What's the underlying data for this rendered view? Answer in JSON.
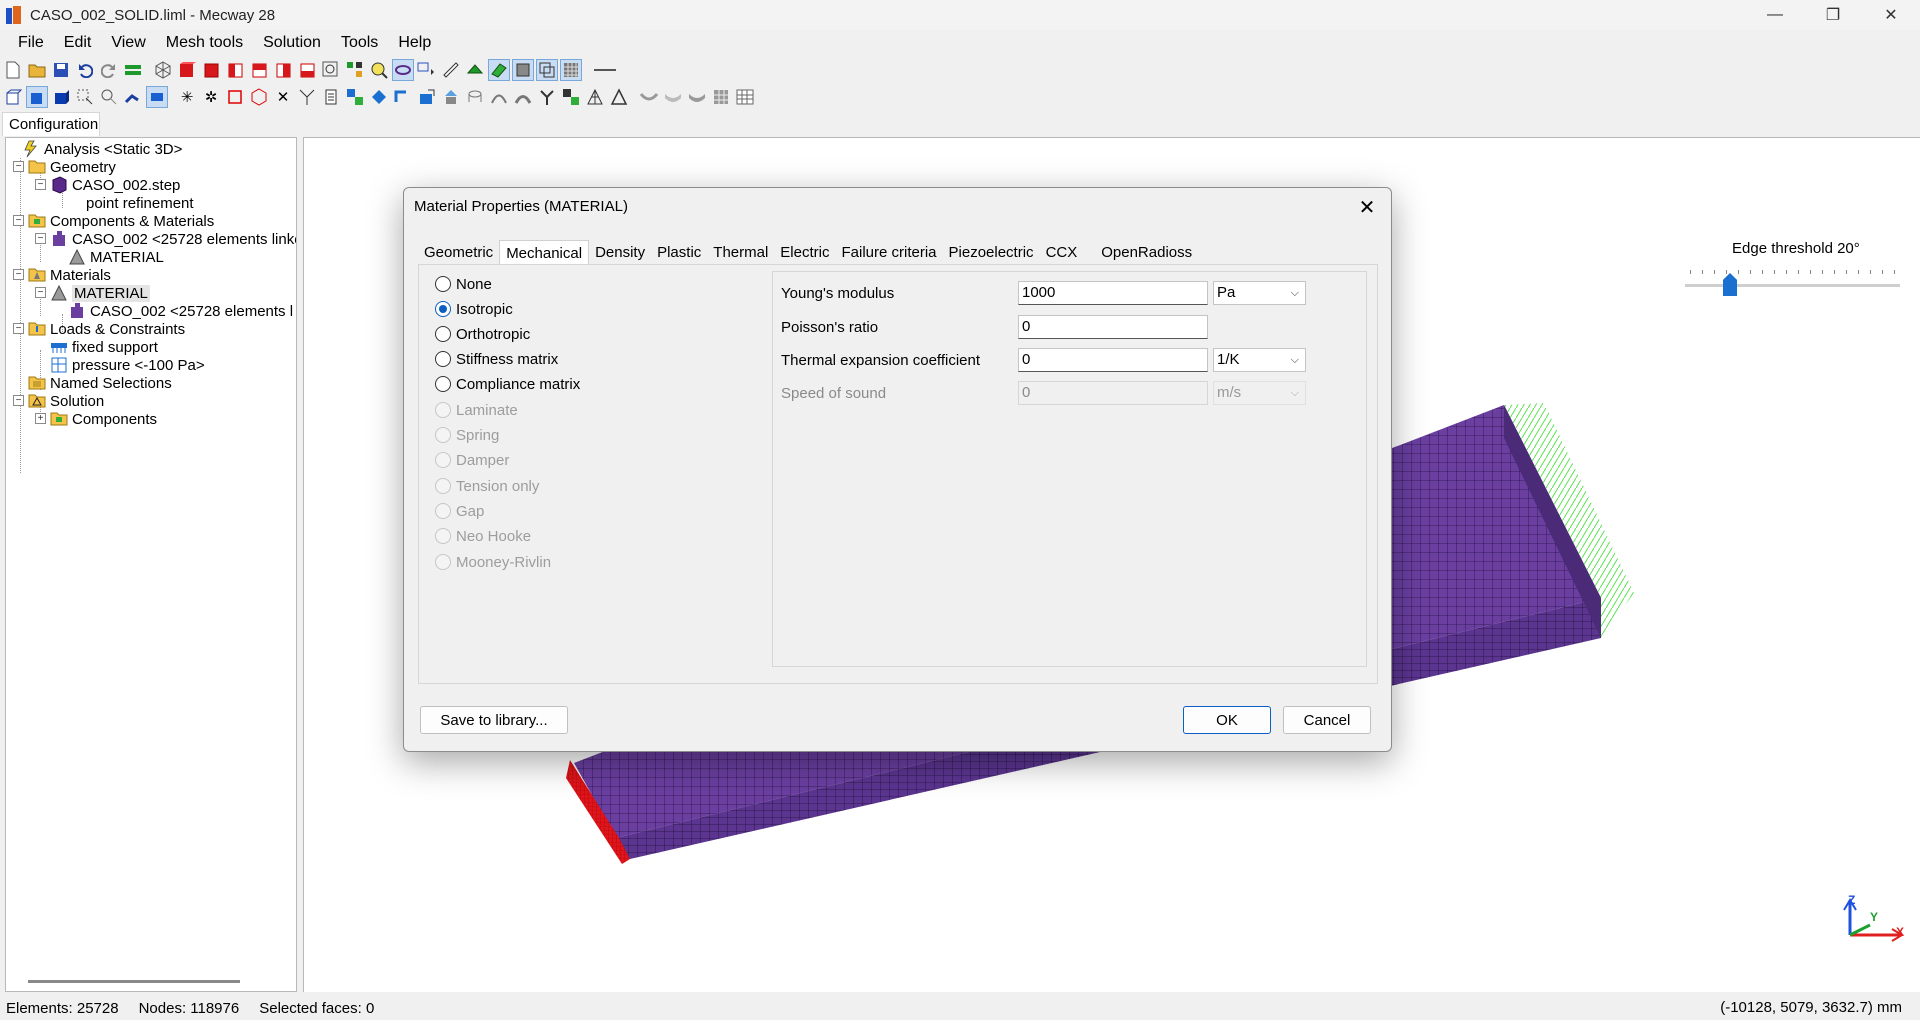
{
  "window": {
    "title": "CASO_002_SOLID.liml - Mecway 28",
    "minimize": "—",
    "restore": "❐",
    "close": "✕"
  },
  "menu": [
    "File",
    "Edit",
    "View",
    "Mesh tools",
    "Solution",
    "Tools",
    "Help"
  ],
  "config_tab": "Configuration",
  "tree": {
    "analysis": "Analysis <Static 3D>",
    "geometry": "Geometry",
    "geometry_file": "CASO_002.step",
    "point_refinement": "point refinement",
    "components_materials": "Components & Materials",
    "component_item": "CASO_002 <25728 elements linke",
    "component_material": "MATERIAL",
    "materials": "Materials",
    "material_item": "MATERIAL",
    "material_component": "CASO_002 <25728 elements l",
    "loads": "Loads & Constraints",
    "fixed_support": "fixed support",
    "pressure": "pressure <-100 Pa>",
    "named_selections": "Named Selections",
    "solution": "Solution",
    "solution_components": "Components"
  },
  "edge_threshold": {
    "label": "Edge threshold 20°",
    "value_deg": 20
  },
  "axes": {
    "x": "X",
    "y": "Y",
    "z": "Z"
  },
  "dialog": {
    "title": "Material Properties (MATERIAL)",
    "close": "✕",
    "tabs": [
      "Geometric",
      "Mechanical",
      "Density",
      "Plastic",
      "Thermal",
      "Electric",
      "Failure criteria",
      "Piezoelectric",
      "CCX",
      "OpenRadioss"
    ],
    "active_tab": "Mechanical",
    "models": [
      {
        "label": "None",
        "state": "enabled"
      },
      {
        "label": "Isotropic",
        "state": "checked"
      },
      {
        "label": "Orthotropic",
        "state": "enabled"
      },
      {
        "label": "Stiffness matrix",
        "state": "enabled"
      },
      {
        "label": "Compliance matrix",
        "state": "enabled"
      },
      {
        "label": "Laminate",
        "state": "disabled"
      },
      {
        "label": "Spring",
        "state": "disabled"
      },
      {
        "label": "Damper",
        "state": "disabled"
      },
      {
        "label": "Tension only",
        "state": "disabled"
      },
      {
        "label": "Gap",
        "state": "disabled"
      },
      {
        "label": "Neo Hooke",
        "state": "disabled"
      },
      {
        "label": "Mooney-Rivlin",
        "state": "disabled"
      }
    ],
    "props": {
      "youngs": {
        "label": "Young's modulus",
        "value": "1000",
        "unit": "Pa"
      },
      "poisson": {
        "label": "Poisson's ratio",
        "value": "0"
      },
      "thermal": {
        "label": "Thermal expansion coefficient",
        "value": "0",
        "unit": "1/K"
      },
      "sound": {
        "label": "Speed of sound",
        "value": "0",
        "unit": "m/s"
      }
    },
    "buttons": {
      "save": "Save to library...",
      "ok": "OK",
      "cancel": "Cancel"
    }
  },
  "status": {
    "elements": "Elements: 25728",
    "nodes": "Nodes: 118976",
    "selected": "Selected faces: 0",
    "coords": "(-10128, 5079, 3632.7) mm"
  },
  "colors": {
    "mesh": "#6a3fa0",
    "fixed": "#e0141a",
    "pressure": "#4be040",
    "accent": "#0b5fc0"
  }
}
